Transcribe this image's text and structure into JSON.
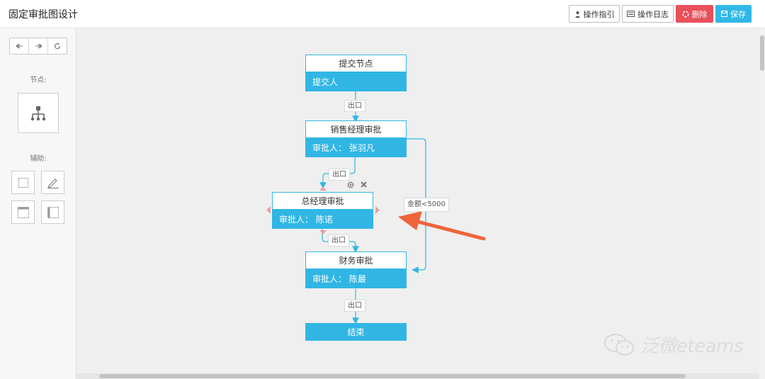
{
  "header": {
    "title": "固定审批图设计",
    "buttons": {
      "guide": "操作指引",
      "log": "操作日志",
      "delete": "删除",
      "save": "保存"
    }
  },
  "sidebar": {
    "undo_icons": [
      "undo-icon",
      "redo-icon",
      "refresh-icon"
    ],
    "nodes_label": "节点:",
    "assist_label": "辅助:"
  },
  "flow": {
    "nodes": [
      {
        "title": "提交节点",
        "body": "提交人"
      },
      {
        "title": "销售经理审批",
        "body": "审批人： 张羽凡"
      },
      {
        "title": "总经理审批",
        "body": "审批人： 陈诺"
      },
      {
        "title": "财务审批",
        "body": "审批人： 陈最"
      }
    ],
    "end_label": "结束",
    "exit_label": "出口",
    "condition_label": "金额<5000"
  },
  "watermark": {
    "text": "泛微eteams"
  },
  "colors": {
    "accent": "#31b6e4",
    "danger": "#e9505a",
    "arrow": "#f0643c",
    "handle": "#e8a0a6"
  }
}
